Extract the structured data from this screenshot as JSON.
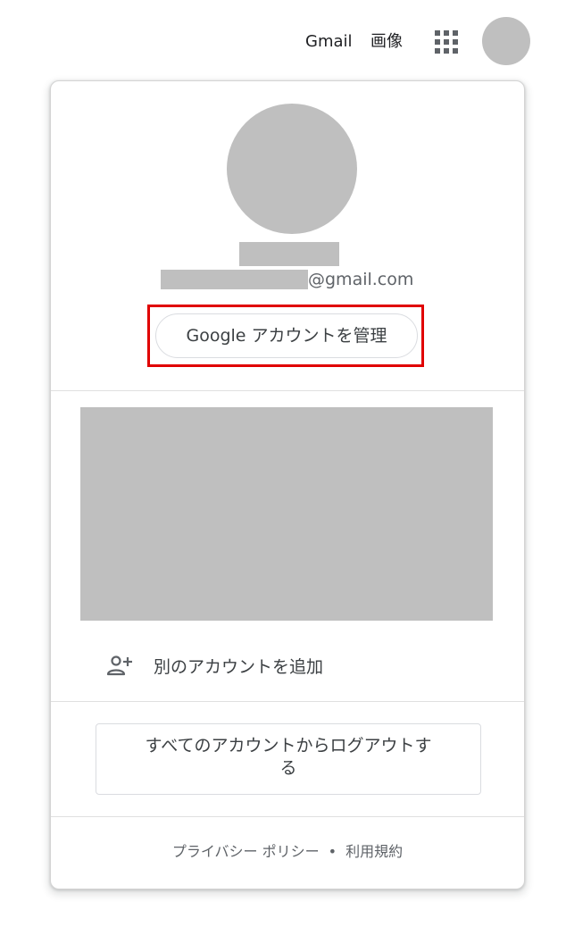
{
  "topbar": {
    "gmail_label": "Gmail",
    "images_label": "画像",
    "apps_icon": "apps-grid-icon",
    "avatar_color": "#bfbfbf"
  },
  "account_panel": {
    "email_domain": "@gmail.com",
    "manage_account_label": "Google アカウントを管理",
    "highlight_color": "#e00000",
    "add_account_icon": "person-add-icon",
    "add_account_label": "別のアカウントを追加",
    "sign_out_label": "すべてのアカウントからログアウトする",
    "footer": {
      "privacy_label": "プライバシー ポリシー",
      "separator": "•",
      "terms_label": "利用規約"
    }
  }
}
